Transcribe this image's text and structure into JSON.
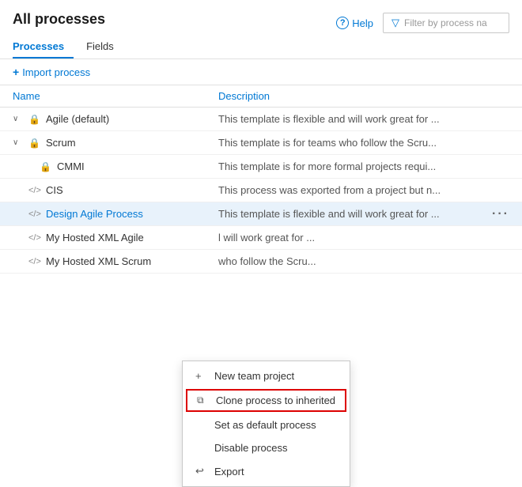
{
  "header": {
    "title": "All processes",
    "help_label": "Help",
    "filter_placeholder": "Filter by process na"
  },
  "tabs": [
    {
      "id": "processes",
      "label": "Processes",
      "active": true
    },
    {
      "id": "fields",
      "label": "Fields",
      "active": false
    }
  ],
  "toolbar": {
    "import_label": "Import process"
  },
  "table": {
    "col_name": "Name",
    "col_desc": "Description"
  },
  "processes": [
    {
      "id": "agile",
      "name": "Agile (default)",
      "icon_type": "lock",
      "expandable": true,
      "link": false,
      "description": "This template is flexible and will work great for ...",
      "indented": false
    },
    {
      "id": "scrum",
      "name": "Scrum",
      "icon_type": "lock",
      "expandable": true,
      "link": false,
      "description": "This template is for teams who follow the Scru...",
      "indented": false
    },
    {
      "id": "cmmi",
      "name": "CMMI",
      "icon_type": "lock",
      "expandable": false,
      "link": false,
      "description": "This template is for more formal projects requi...",
      "indented": true
    },
    {
      "id": "cis",
      "name": "CIS",
      "icon_type": "code",
      "expandable": false,
      "link": false,
      "description": "This process was exported from a project but n...",
      "indented": false
    },
    {
      "id": "design-agile",
      "name": "Design Agile Process",
      "icon_type": "code",
      "expandable": false,
      "link": true,
      "highlighted": true,
      "description": "This template is flexible and will work great for ...",
      "indented": false
    },
    {
      "id": "my-hosted-xml-agile",
      "name": "My Hosted XML Agile",
      "icon_type": "code",
      "expandable": false,
      "link": false,
      "description": "l will work great for ...",
      "indented": false
    },
    {
      "id": "my-hosted-xml-scrum",
      "name": "My Hosted XML Scrum",
      "icon_type": "code",
      "expandable": false,
      "link": false,
      "description": "who follow the Scru...",
      "indented": false
    }
  ],
  "context_menu": {
    "items": [
      {
        "id": "new-team-project",
        "label": "New team project",
        "icon": "+"
      },
      {
        "id": "clone-process",
        "label": "Clone process to inherited",
        "icon": "clone",
        "highlighted": true
      },
      {
        "id": "set-default",
        "label": "Set as default process",
        "icon": ""
      },
      {
        "id": "disable-process",
        "label": "Disable process",
        "icon": ""
      },
      {
        "id": "export",
        "label": "Export",
        "icon": "↩"
      }
    ]
  }
}
